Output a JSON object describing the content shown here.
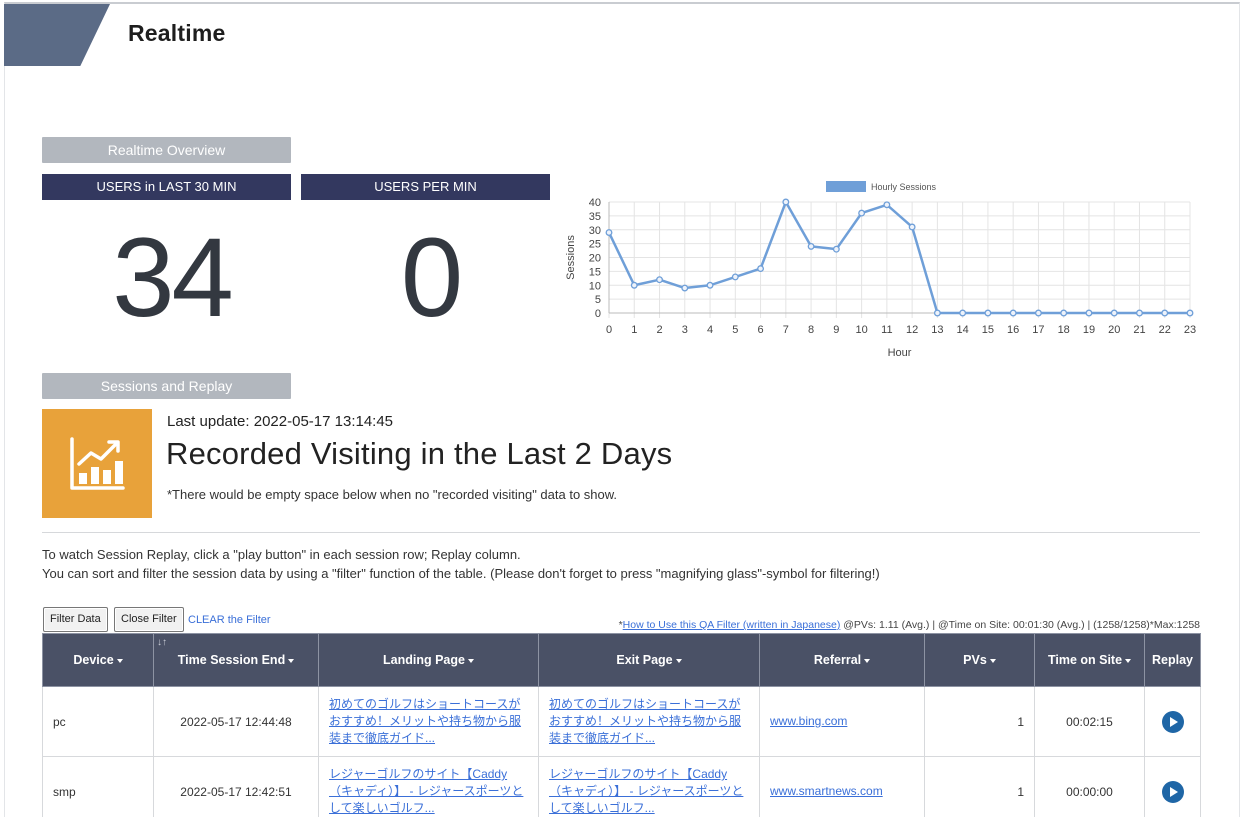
{
  "header": {
    "title": "Realtime"
  },
  "overview": {
    "section_label": "Realtime Overview",
    "users_last_30_label": "USERS in LAST 30 MIN",
    "users_last_30_value": "34",
    "users_per_min_label": "USERS PER MIN",
    "users_per_min_value": "0"
  },
  "chart_data": {
    "type": "line",
    "x": [
      0,
      1,
      2,
      3,
      4,
      5,
      6,
      7,
      8,
      9,
      10,
      11,
      12,
      13,
      14,
      15,
      16,
      17,
      18,
      19,
      20,
      21,
      22,
      23
    ],
    "series": [
      {
        "name": "Hourly Sessions",
        "values": [
          29,
          10,
          12,
          9,
          10,
          13,
          16,
          40,
          24,
          23,
          36,
          39,
          31,
          0,
          0,
          0,
          0,
          0,
          0,
          0,
          0,
          0,
          0,
          0
        ]
      }
    ],
    "xlabel": "Hour",
    "ylabel": "Sessions",
    "ylim": [
      0,
      40
    ],
    "yticks": [
      0,
      5,
      10,
      15,
      20,
      25,
      30,
      35,
      40
    ],
    "grid": true,
    "legend": "top",
    "color": "#6f9fd8"
  },
  "sessions": {
    "section_label": "Sessions and Replay",
    "last_update": "Last update: 2022-05-17 13:14:45",
    "heading": "Recorded Visiting in the Last 2 Days",
    "note": "*There would be empty space below when no \"recorded visiting\" data to show.",
    "instruction_1": "To watch Session Replay, click a \"play button\" in each session row; Replay column.",
    "instruction_2": "You can sort and filter the session data by using a \"filter\" function of the table. (Please don't forget to press \"magnifying glass\"-symbol for filtering!)",
    "accent_color": "#e8a23a"
  },
  "filter": {
    "filter_data_label": "Filter Data",
    "close_filter_label": "Close Filter",
    "clear_label": "CLEAR the Filter",
    "howto_prefix": "*",
    "howto_link": "How to Use this QA Filter (written in Japanese)",
    "stats_text": " @PVs: 1.11 (Avg.) | @Time on Site: 00:01:30 (Avg.) | (1258/1258)*Max:1258"
  },
  "table": {
    "sort_marker": "↓↑",
    "headers": {
      "device": "Device",
      "time_end": "Time Session End",
      "landing": "Landing Page",
      "exit": "Exit Page",
      "referral": "Referral",
      "pvs": "PVs",
      "time_on_site": "Time on Site",
      "replay": "Replay"
    },
    "rows": [
      {
        "device": "pc",
        "time_end": "2022-05-17 12:44:48",
        "landing": "初めてのゴルフはショートコースがおすすめ！メリットや持ち物から服装まで徹底ガイド...",
        "exit": "初めてのゴルフはショートコースがおすすめ！メリットや持ち物から服装まで徹底ガイド...",
        "referral": "www.bing.com",
        "pvs": "1",
        "time_on_site": "00:02:15"
      },
      {
        "device": "smp",
        "time_end": "2022-05-17 12:42:51",
        "landing": "レジャーゴルフのサイト【Caddy（キャディ）】 - レジャースポーツとして楽しいゴルフ...",
        "exit": "レジャーゴルフのサイト【Caddy（キャディ）】 - レジャースポーツとして楽しいゴルフ...",
        "referral": "www.smartnews.com",
        "pvs": "1",
        "time_on_site": "00:00:00"
      }
    ]
  }
}
